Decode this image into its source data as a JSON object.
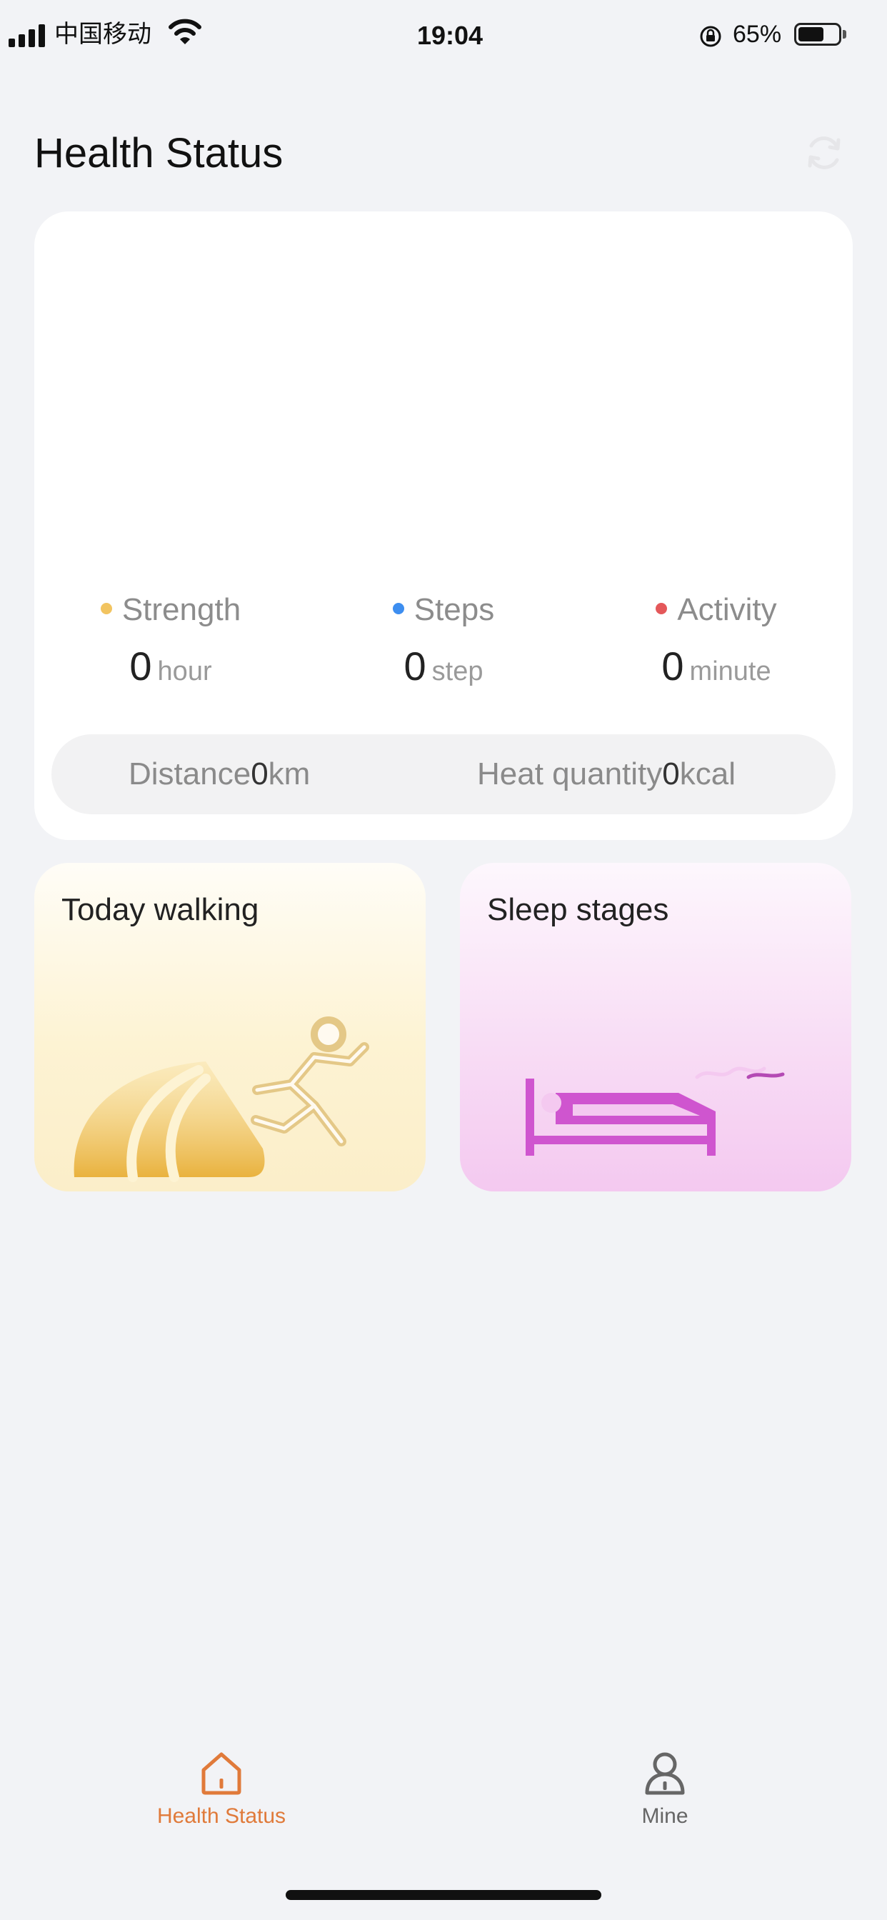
{
  "status_bar": {
    "carrier": "中国移动",
    "time": "19:04",
    "battery_percent": "65%",
    "battery_level": 0.65
  },
  "header": {
    "title": "Health Status",
    "refresh_icon": "refresh-icon"
  },
  "summary": {
    "metrics": [
      {
        "label": "Strength",
        "value": "0",
        "unit": "hour",
        "color": "#f2c460"
      },
      {
        "label": "Steps",
        "value": "0",
        "unit": "step",
        "color": "#3d8ef0"
      },
      {
        "label": "Activity",
        "value": "0",
        "unit": "minute",
        "color": "#e4585a"
      }
    ],
    "distance": {
      "label": "Distance",
      "value": "0",
      "unit": "km"
    },
    "heat": {
      "label": "Heat quantity",
      "value": "0",
      "unit": "kcal"
    }
  },
  "tiles": {
    "walking": {
      "title": "Today walking",
      "icon": "running-person-icon"
    },
    "sleep": {
      "title": "Sleep stages",
      "icon": "bed-moon-icon"
    }
  },
  "tab_bar": {
    "tabs": [
      {
        "label": "Health Status",
        "icon": "home-icon",
        "active": true
      },
      {
        "label": "Mine",
        "icon": "person-icon",
        "active": false
      }
    ],
    "active_color": "#e07a3a",
    "inactive_color": "#666666"
  }
}
